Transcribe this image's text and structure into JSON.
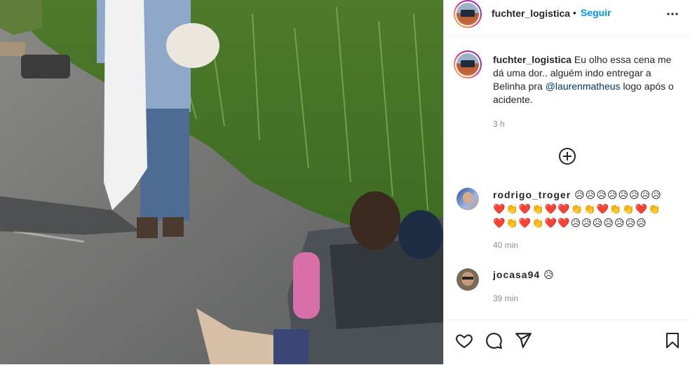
{
  "header": {
    "username": "fuchter_logistica",
    "separator": "•",
    "follow_label": "Seguir",
    "more_icon": "more-horizontal-icon"
  },
  "caption": {
    "username": "fuchter_logistica",
    "text_before_mention": "Eu olho essa cena me dá uma dor.. alguém indo entregar a Belinha pra",
    "mention": "@laurenmatheus",
    "text_after_mention": "logo após o acidente.",
    "time": "3 h"
  },
  "load_more_icon": "plus-circle-icon",
  "comments": [
    {
      "username": "rodrigo_troger",
      "line1": "😥😥😥😥😥😥😥😥",
      "line2": "❤️👏❤️👏❤️❤️👏👏❤️👏👏❤️👏",
      "line3": "❤️👏❤️👏❤️❤️😥😥😥😥😥😥😥",
      "time": "40 min"
    },
    {
      "username": "jocasa94",
      "text": "😥",
      "time": "39 min"
    }
  ],
  "actions": {
    "like_icon": "heart-icon",
    "comment_icon": "comment-icon",
    "share_icon": "paper-plane-icon",
    "save_icon": "bookmark-icon"
  },
  "colors": {
    "link": "#0095f6",
    "mention": "#00376b",
    "text": "#262626",
    "muted": "#8e8e8e",
    "border": "#dbdbdb"
  }
}
